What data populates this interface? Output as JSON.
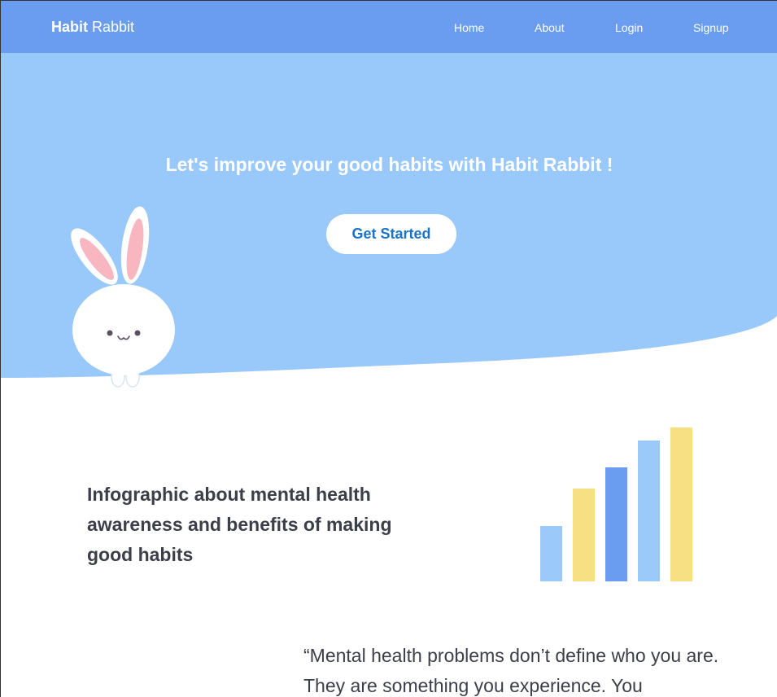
{
  "nav": {
    "brand_bold": "Habit",
    "brand_rest": "Rabbit",
    "links": [
      "Home",
      "About",
      "Login",
      "Signup"
    ]
  },
  "hero": {
    "title": "Let's improve your good habits with Habit Rabbit !",
    "cta_label": "Get Started"
  },
  "info": {
    "heading": "Infographic about mental health awareness and benefits of making good habits"
  },
  "quote": {
    "text": "“Mental health problems don’t define who you are. They are something you experience. You"
  },
  "colors": {
    "navbar": "#6a9cf0",
    "hero": "#99c8fb",
    "bar_light_blue": "#9ac9fa",
    "bar_yellow": "#f7df84",
    "bar_blue": "#6a9cf0",
    "cta_text": "#1a73c8"
  }
}
